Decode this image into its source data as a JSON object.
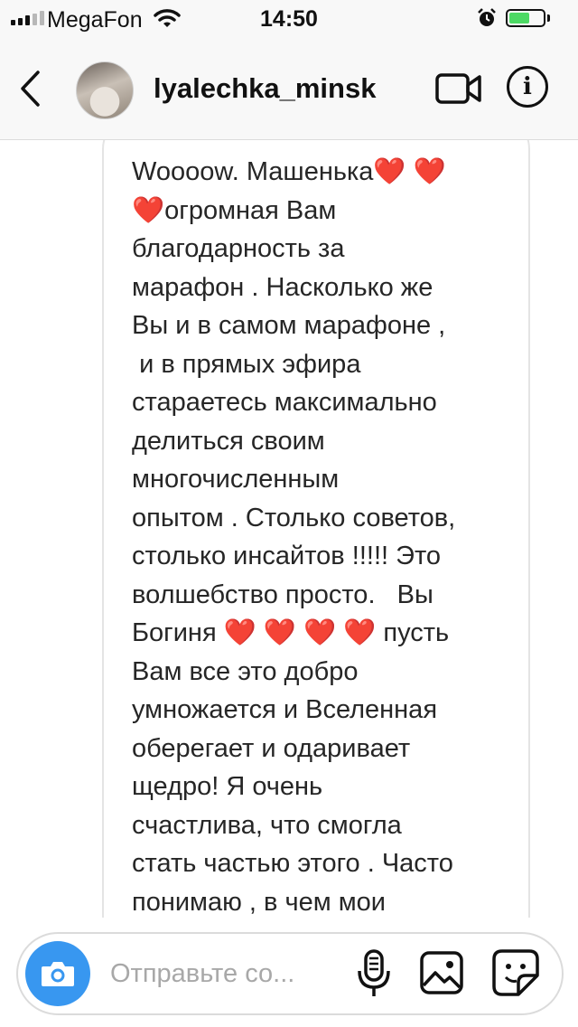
{
  "status_bar": {
    "carrier": "MegaFon",
    "time": "14:50",
    "signal_bars_filled": 3,
    "signal_bars_total": 5,
    "battery_level": 0.6,
    "battery_color": "#4cd964"
  },
  "header": {
    "username": "lyalechka_minsk",
    "info_glyph": "i",
    "icons": [
      "back-chevron-icon",
      "avatar",
      "video-call-icon",
      "info-icon"
    ]
  },
  "message": {
    "text": "Woooow. Машенька❤️ ❤️\n❤️огромная Вам\nблагодарность за\nмарафон . Насколько же\nВы и в самом марафоне ,\n и в прямых эфира\nстараетесь максимально\nделиться своим\nмногочисленным\nопытом . Столько советов,\nстолько инсайтов !!!!! Это\nволшебство просто.   Вы\nБогиня ❤️ ❤️ ❤️ ❤️ пусть\nВам все это добро\nумножается и Вселенная\nоберегает и одаривает\nщедро! Я очень\nсчастлива, что смогла\nстать частью этого . Часто\nпонимаю , в чем мои"
  },
  "composer": {
    "placeholder": "Отправьте со...",
    "accent_color": "#3897f0",
    "icons": [
      "camera-icon",
      "microphone-icon",
      "gallery-icon",
      "sticker-icon"
    ]
  }
}
